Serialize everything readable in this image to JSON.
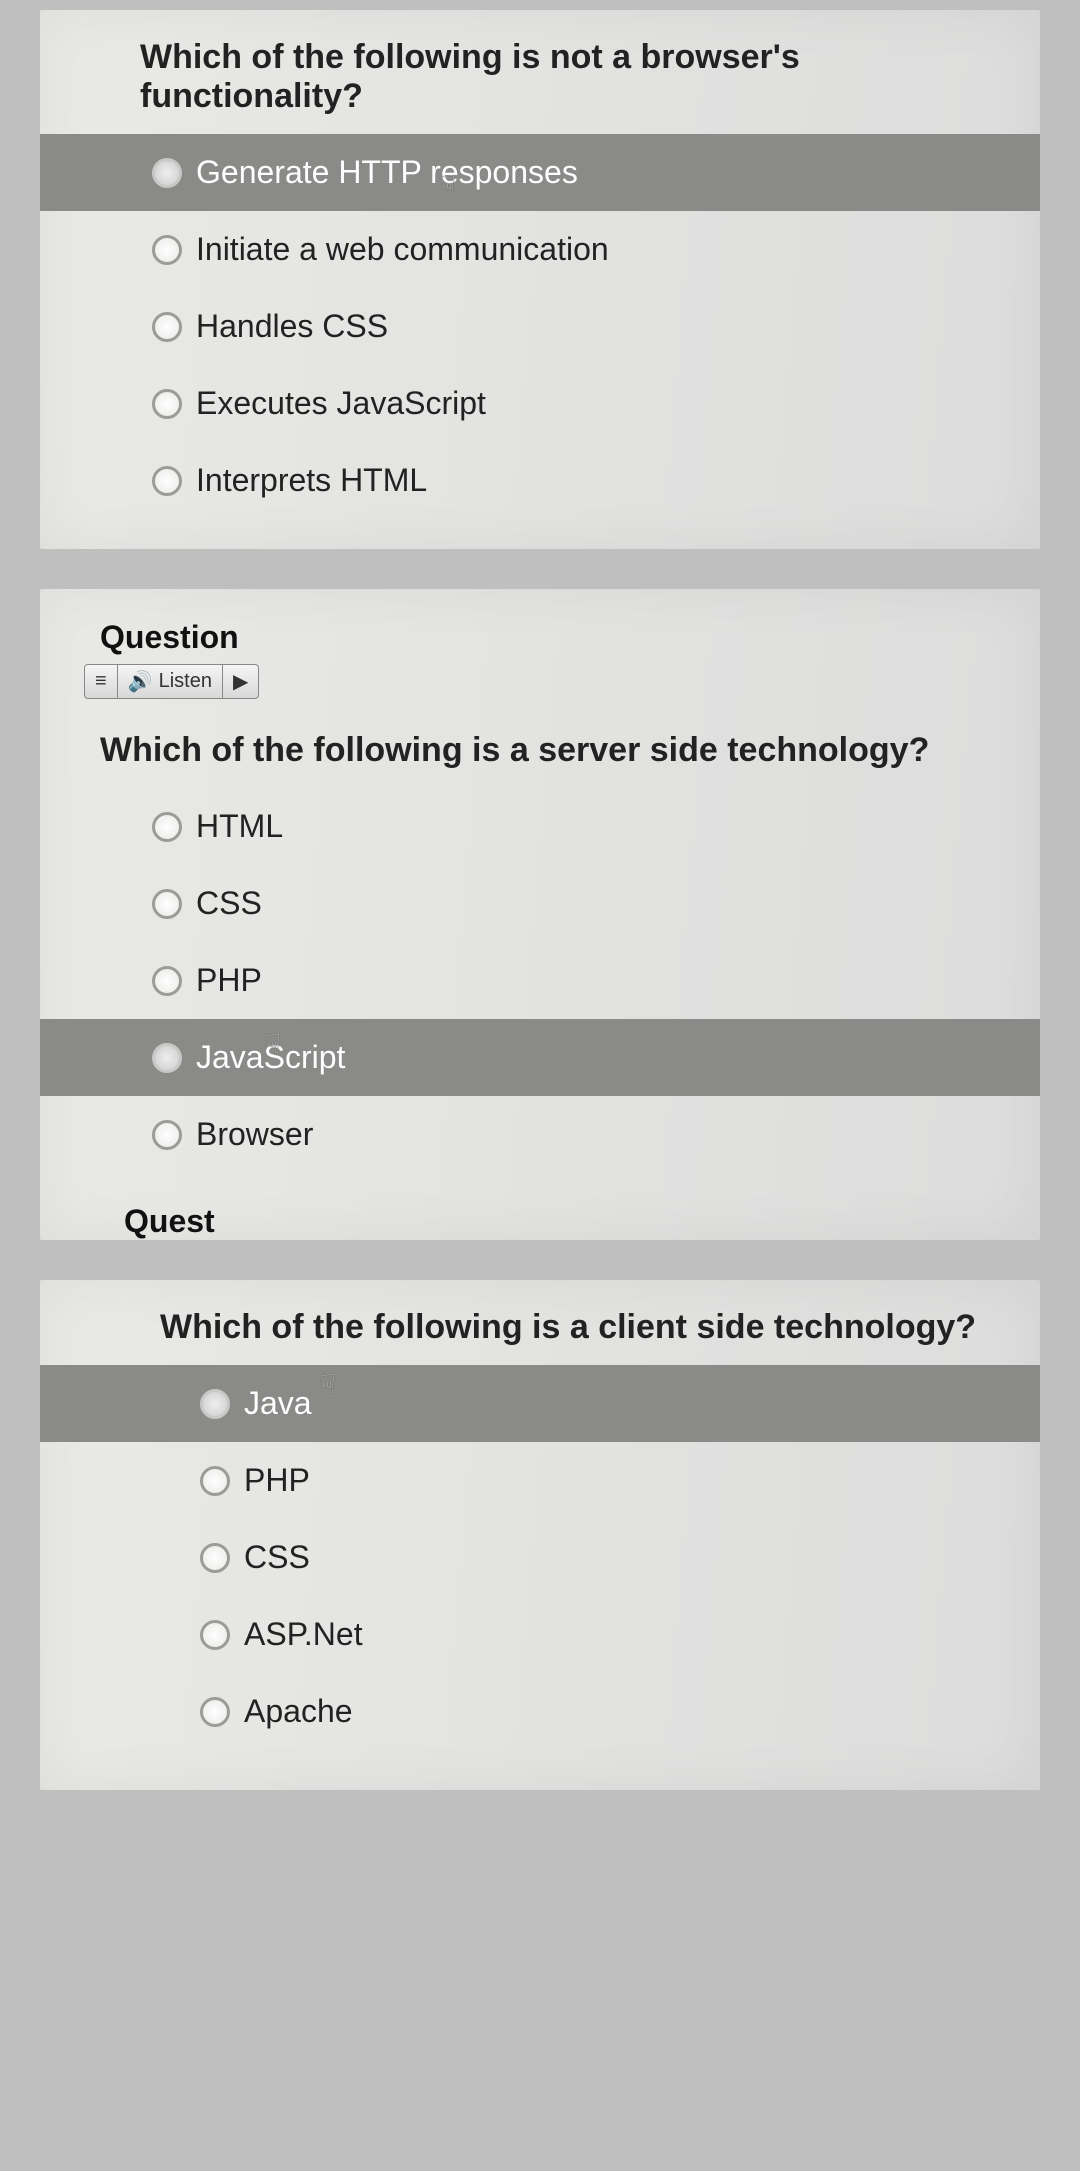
{
  "q1": {
    "prompt": "Which of the following is not a browser's functionality?",
    "options": [
      {
        "label": "Generate HTTP responses",
        "hovered": true
      },
      {
        "label": "Initiate a web communication",
        "hovered": false
      },
      {
        "label": "Handles CSS",
        "hovered": false
      },
      {
        "label": "Executes JavaScript",
        "hovered": false
      },
      {
        "label": "Interprets HTML",
        "hovered": false
      }
    ]
  },
  "q2": {
    "title": "Question",
    "listen": "Listen",
    "prompt": "Which of the following is a server side technology?",
    "options": [
      {
        "label": "HTML",
        "hovered": false
      },
      {
        "label": "CSS",
        "hovered": false
      },
      {
        "label": "PHP",
        "hovered": false
      },
      {
        "label": "JavaScript",
        "hovered": true
      },
      {
        "label": "Browser",
        "hovered": false
      }
    ],
    "tail": "Quest"
  },
  "q3": {
    "prompt": "Which of the following is a client side technology?",
    "options": [
      {
        "label": "Java",
        "hovered": true
      },
      {
        "label": "PHP",
        "hovered": false
      },
      {
        "label": "CSS",
        "hovered": false
      },
      {
        "label": "ASP.Net",
        "hovered": false
      },
      {
        "label": "Apache",
        "hovered": false
      }
    ]
  },
  "glyphs": {
    "menu": "≡",
    "speaker": "🔊",
    "play": "▶",
    "cursor": "☟"
  }
}
